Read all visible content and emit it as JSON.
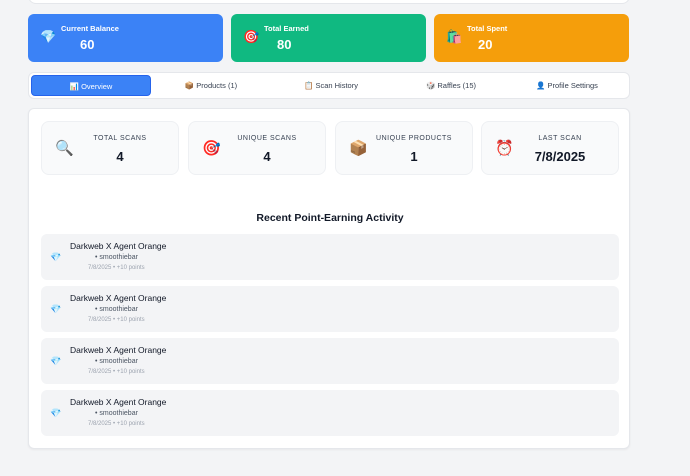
{
  "summary": {
    "balance": {
      "label": "Current Balance",
      "value": "60",
      "icon": "💎",
      "color": "#3b82f6"
    },
    "earned": {
      "label": "Total Earned",
      "value": "80",
      "icon": "🎯",
      "color": "#10b981"
    },
    "spent": {
      "label": "Total Spent",
      "value": "20",
      "icon": "🛍️",
      "color": "#f59e0b"
    }
  },
  "tabs": [
    {
      "icon": "📊",
      "label": "Overview",
      "active": true
    },
    {
      "icon": "📦",
      "label": "Products (1)"
    },
    {
      "icon": "📋",
      "label": "Scan History"
    },
    {
      "icon": "🎲",
      "label": "Raffles (15)"
    },
    {
      "icon": "👤",
      "label": "Profile Settings"
    }
  ],
  "stats": [
    {
      "icon": "🔍",
      "label": "TOTAL SCANS",
      "value": "4"
    },
    {
      "icon": "🎯",
      "label": "UNIQUE SCANS",
      "value": "4"
    },
    {
      "icon": "📦",
      "label": "UNIQUE PRODUCTS",
      "value": "1"
    },
    {
      "icon": "⏰",
      "label": "LAST SCAN",
      "value": "7/8/2025"
    }
  ],
  "activity": {
    "heading": "Recent Point-Earning Activity",
    "items": [
      {
        "icon": "💎",
        "title": "Darkweb X Agent Orange",
        "venue": "• smoothiebar",
        "meta": "7/8/2025 • +10 points"
      },
      {
        "icon": "💎",
        "title": "Darkweb X Agent Orange",
        "venue": "• smoothiebar",
        "meta": "7/8/2025 • +10 points"
      },
      {
        "icon": "💎",
        "title": "Darkweb X Agent Orange",
        "venue": "• smoothiebar",
        "meta": "7/8/2025 • +10 points"
      },
      {
        "icon": "💎",
        "title": "Darkweb X Agent Orange",
        "venue": "• smoothiebar",
        "meta": "7/8/2025 • +10 points"
      }
    ]
  }
}
